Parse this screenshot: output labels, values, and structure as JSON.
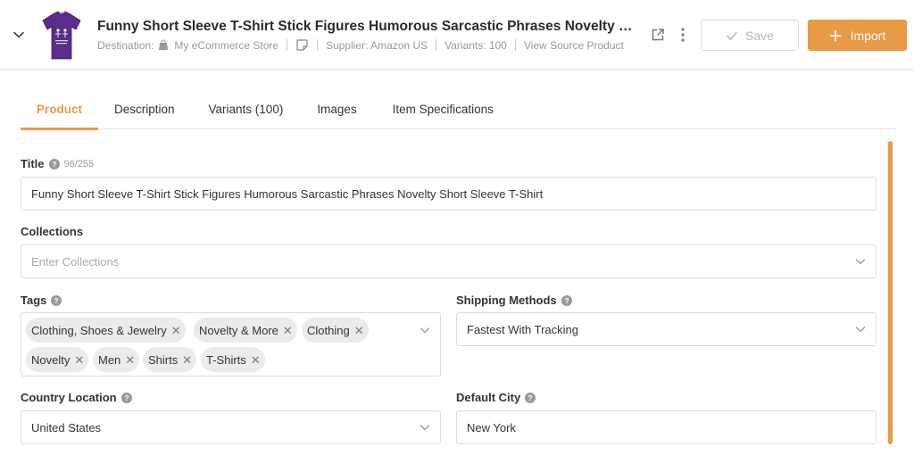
{
  "header": {
    "title": "Funny Short Sleeve T-Shirt Stick Figures Humorous Sarcastic Phrases Novelty Shor…",
    "destination_label": "Destination:",
    "destination_value": "My eCommerce Store",
    "supplier": "Supplier: Amazon US",
    "variants": "Variants: 100",
    "view_source": "View Source Product",
    "save_label": "Save",
    "import_label": "Import"
  },
  "tabs": [
    {
      "label": "Product",
      "active": true
    },
    {
      "label": "Description"
    },
    {
      "label": "Variants (100)"
    },
    {
      "label": "Images"
    },
    {
      "label": "Item Specifications"
    }
  ],
  "form": {
    "title_label": "Title",
    "title_counter": "96/255",
    "title_value": "Funny Short Sleeve T-Shirt Stick Figures Humorous Sarcastic Phrases Novelty Short Sleeve T-Shirt",
    "collections_label": "Collections",
    "collections_placeholder": "Enter Collections",
    "tags_label": "Tags",
    "tags": [
      "Clothing, Shoes & Jewelry",
      "Novelty & More",
      "Clothing",
      "Novelty",
      "Men",
      "Shirts",
      "T-Shirts"
    ],
    "shipping_label": "Shipping Methods",
    "shipping_value": "Fastest With Tracking",
    "country_label": "Country Location",
    "country_value": "United States",
    "city_label": "Default City",
    "city_value": "New York"
  },
  "colors": {
    "accent": "#e89a45",
    "product_shirt": "#5a2d8c"
  }
}
